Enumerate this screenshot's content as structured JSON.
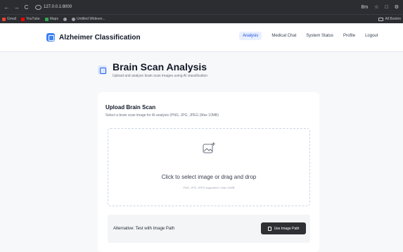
{
  "browser": {
    "nav_back": "←",
    "nav_forward": "→",
    "nav_reload": "C",
    "url": "127.0.0.1:8000",
    "right_icons": [
      "8m",
      "☆",
      "□",
      "⚙"
    ],
    "bookmarks": [
      {
        "label": "Gmail",
        "color": "#ea4335"
      },
      {
        "label": "YouTube",
        "color": "#ff0000"
      },
      {
        "label": "Maps",
        "color": "#34a853"
      },
      {
        "label": "",
        "color": "#9aa0a6"
      },
      {
        "label": "Untitled Widever...",
        "color": "#9aa0a6"
      }
    ],
    "all_bookmarks": "All Bookm"
  },
  "header": {
    "title": "Alzheimer Classification",
    "nav": [
      "Analysis",
      "Medical Chat",
      "System Status",
      "Profile",
      "Logout"
    ],
    "active_nav": "Analysis"
  },
  "page": {
    "title": "Brain Scan Analysis",
    "subtitle": "Upload and analyze brain scan images using AI classification"
  },
  "upload": {
    "title": "Upload Brain Scan",
    "subtitle": "Select a brain scan image for AI analysis (PNG, JPG, JPEG (Max 10MB)",
    "drop_main": "Click to select image or drag and drop",
    "drop_hint": "PNG, JPG, JPEG supported • Max 10MB",
    "alt_label": "Alternative: Test with Image Path",
    "alt_button": "Use Image Path"
  },
  "colors": {
    "accent": "#3b82f6",
    "active_nav_bg": "#e8efff",
    "button_dark": "#2f3033"
  }
}
